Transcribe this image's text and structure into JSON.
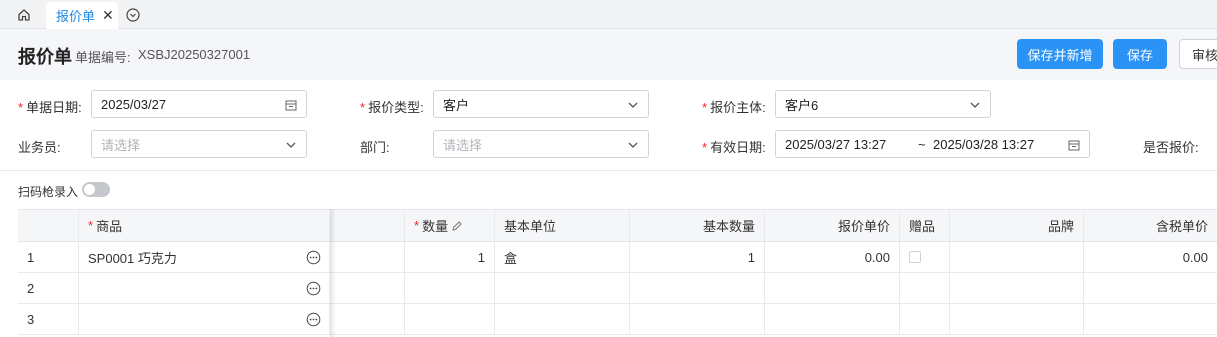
{
  "tabs": {
    "active_label": "报价单",
    "close_glyph": "✕"
  },
  "header": {
    "title": "报价单",
    "doc_no_label": "单据编号:",
    "doc_no": "XSBJ20250327001",
    "buttons": {
      "save_new": "保存并新增",
      "save": "保存",
      "audit": "审核"
    }
  },
  "form": {
    "doc_date": {
      "label": "单据日期:",
      "value": "2025/03/27",
      "required": true
    },
    "quote_type": {
      "label": "报价类型:",
      "value": "客户",
      "required": true
    },
    "quote_subject": {
      "label": "报价主体:",
      "value": "客户6",
      "required": true
    },
    "salesperson": {
      "label": "业务员:",
      "placeholder": "请选择"
    },
    "department": {
      "label": "部门:",
      "placeholder": "请选择"
    },
    "valid_date": {
      "label": "有效日期:",
      "start": "2025/03/27 13:27",
      "separator": "~",
      "end": "2025/03/28 13:27",
      "required": true
    },
    "is_quoted": {
      "label": "是否报价:"
    },
    "scan_label": "扫码枪录入",
    "scan_enabled": false
  },
  "table": {
    "columns": {
      "product": "商品",
      "quantity": "数量",
      "base_unit": "基本单位",
      "base_qty": "基本数量",
      "price": "报价单价",
      "gift": "赠品",
      "brand": "品牌",
      "tax_price": "含税单价"
    },
    "rows": [
      {
        "no": "1",
        "product": "SP0001 巧克力",
        "quantity": "1",
        "base_unit": "盒",
        "base_qty": "1",
        "price": "0.00",
        "gift": false,
        "brand": "",
        "tax_price": "0.00"
      },
      {
        "no": "2",
        "product": "",
        "quantity": "",
        "base_unit": "",
        "base_qty": "",
        "price": "",
        "gift": null,
        "brand": "",
        "tax_price": ""
      },
      {
        "no": "3",
        "product": "",
        "quantity": "",
        "base_unit": "",
        "base_qty": "",
        "price": "",
        "gift": null,
        "brand": "",
        "tax_price": ""
      }
    ]
  },
  "colors": {
    "primary": "#2b93f5",
    "required": "#f5222d",
    "active_tab_text": "#1e88e5"
  },
  "icons": [
    "home-icon",
    "close-icon",
    "chevron-circle-down-icon",
    "calendar-icon",
    "chevron-down-icon",
    "edit-icon",
    "more-icon"
  ]
}
